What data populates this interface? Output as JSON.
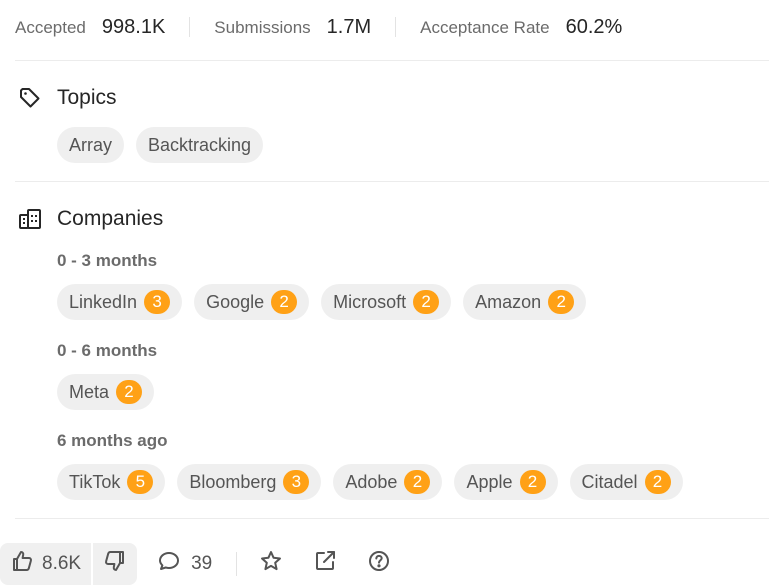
{
  "stats": {
    "accepted": {
      "label": "Accepted",
      "value": "998.1K"
    },
    "submissions": {
      "label": "Submissions",
      "value": "1.7M"
    },
    "acceptance_rate": {
      "label": "Acceptance Rate",
      "value": "60.2%"
    }
  },
  "topics": {
    "title": "Topics",
    "icon": "tag-icon",
    "tags": [
      "Array",
      "Backtracking"
    ]
  },
  "companies": {
    "title": "Companies",
    "icon": "building-icon",
    "accent_color": "#ffa116",
    "groups": [
      {
        "period": "0 - 3 months",
        "items": [
          {
            "name": "LinkedIn",
            "count": "3"
          },
          {
            "name": "Google",
            "count": "2"
          },
          {
            "name": "Microsoft",
            "count": "2"
          },
          {
            "name": "Amazon",
            "count": "2"
          }
        ]
      },
      {
        "period": "0 - 6 months",
        "items": [
          {
            "name": "Meta",
            "count": "2"
          }
        ]
      },
      {
        "period": "6 months ago",
        "items": [
          {
            "name": "TikTok",
            "count": "5"
          },
          {
            "name": "Bloomberg",
            "count": "3"
          },
          {
            "name": "Adobe",
            "count": "2"
          },
          {
            "name": "Apple",
            "count": "2"
          },
          {
            "name": "Citadel",
            "count": "2"
          }
        ]
      }
    ]
  },
  "footer": {
    "likes": "8.6K",
    "comments": "39",
    "icons": [
      "thumbs-up-icon",
      "thumbs-down-icon",
      "comment-icon",
      "star-icon",
      "share-icon",
      "help-icon"
    ]
  }
}
